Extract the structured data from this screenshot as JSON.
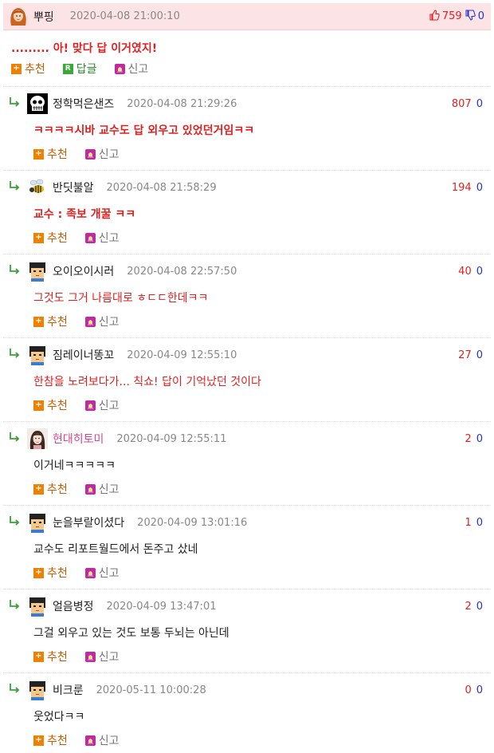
{
  "top": {
    "nick": "뿌핑",
    "date": "2020-04-08 21:00:10",
    "up": "759",
    "down": "0",
    "body": "......... 아! 맞다 답 이거였지!",
    "recommend": "추천",
    "reply": "답글",
    "report": "신고"
  },
  "replies": [
    {
      "nick": "정학먹은샌즈",
      "date": "2020-04-08 21:29:26",
      "up": "807",
      "down": "0",
      "body": "ㅋㅋㅋㅋ시바 교수도 답 외우고 있었던거임ㅋㅋ",
      "recommend": "추천",
      "report": "신고"
    },
    {
      "nick": "반딧불알",
      "date": "2020-04-08 21:58:29",
      "up": "194",
      "down": "0",
      "body": "교수 : 족보 개꿀 ㅋㅋ",
      "recommend": "추천",
      "report": "신고"
    },
    {
      "nick": "오이오이시러",
      "date": "2020-04-08 22:57:50",
      "up": "40",
      "down": "0",
      "body": "그것도 그거 나름대로 ㅎㄷㄷ한데ㅋㅋ",
      "recommend": "추천",
      "report": "신고"
    },
    {
      "nick": "짐레이너똥꼬",
      "date": "2020-04-09 12:55:10",
      "up": "27",
      "down": "0",
      "body": "한참을 노려보다가... 칙쇼! 답이 기억났던 것이다",
      "recommend": "추천",
      "report": "신고"
    },
    {
      "nick": "현대히토미",
      "date": "2020-04-09 12:55:11",
      "up": "2",
      "down": "0",
      "body": "이거네ㅋㅋㅋㅋㅋ",
      "recommend": "추천",
      "report": "신고"
    },
    {
      "nick": "눈을부랄이셨다",
      "date": "2020-04-09 13:01:16",
      "up": "1",
      "down": "0",
      "body": "교수도 리포트월드에서 돈주고 샀네",
      "recommend": "추천",
      "report": "신고"
    },
    {
      "nick": "얼음병정",
      "date": "2020-04-09 13:47:01",
      "up": "2",
      "down": "0",
      "body": "그걸 외우고 있는 것도 보통 두뇌는 아닌데",
      "recommend": "추천",
      "report": "신고"
    },
    {
      "nick": "비크룬",
      "date": "2020-05-11 10:00:28",
      "up": "0",
      "down": "0",
      "body": "웃었다ㅋㅋ",
      "recommend": "추천",
      "report": "신고"
    }
  ],
  "colors": {
    "red": "#e02020",
    "blue": "#2233cc",
    "header_bg": "#fce3e6"
  },
  "icons": [
    "female-avatar-icon",
    "thumbs-up-icon",
    "thumbs-down-icon",
    "plus-icon",
    "reply-r-icon",
    "report-icon",
    "reply-arrow-icon",
    "pixel-avatar-icon"
  ]
}
